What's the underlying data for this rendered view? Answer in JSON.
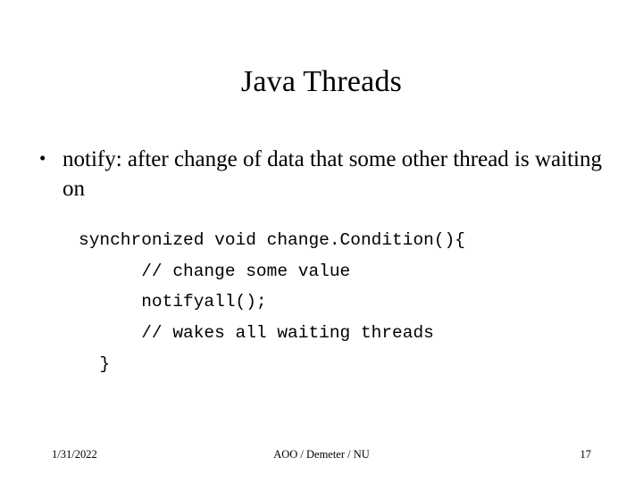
{
  "slide": {
    "title": "Java Threads",
    "bullets": [
      {
        "marker": "•",
        "text": "notify: after change of data that some other thread is waiting on"
      }
    ],
    "code": "synchronized void change.Condition(){\n      // change some value\n      notifyall();\n      // wakes all waiting threads\n  }",
    "footer": {
      "date": "1/31/2022",
      "center": "AOO / Demeter / NU",
      "page": "17"
    }
  }
}
